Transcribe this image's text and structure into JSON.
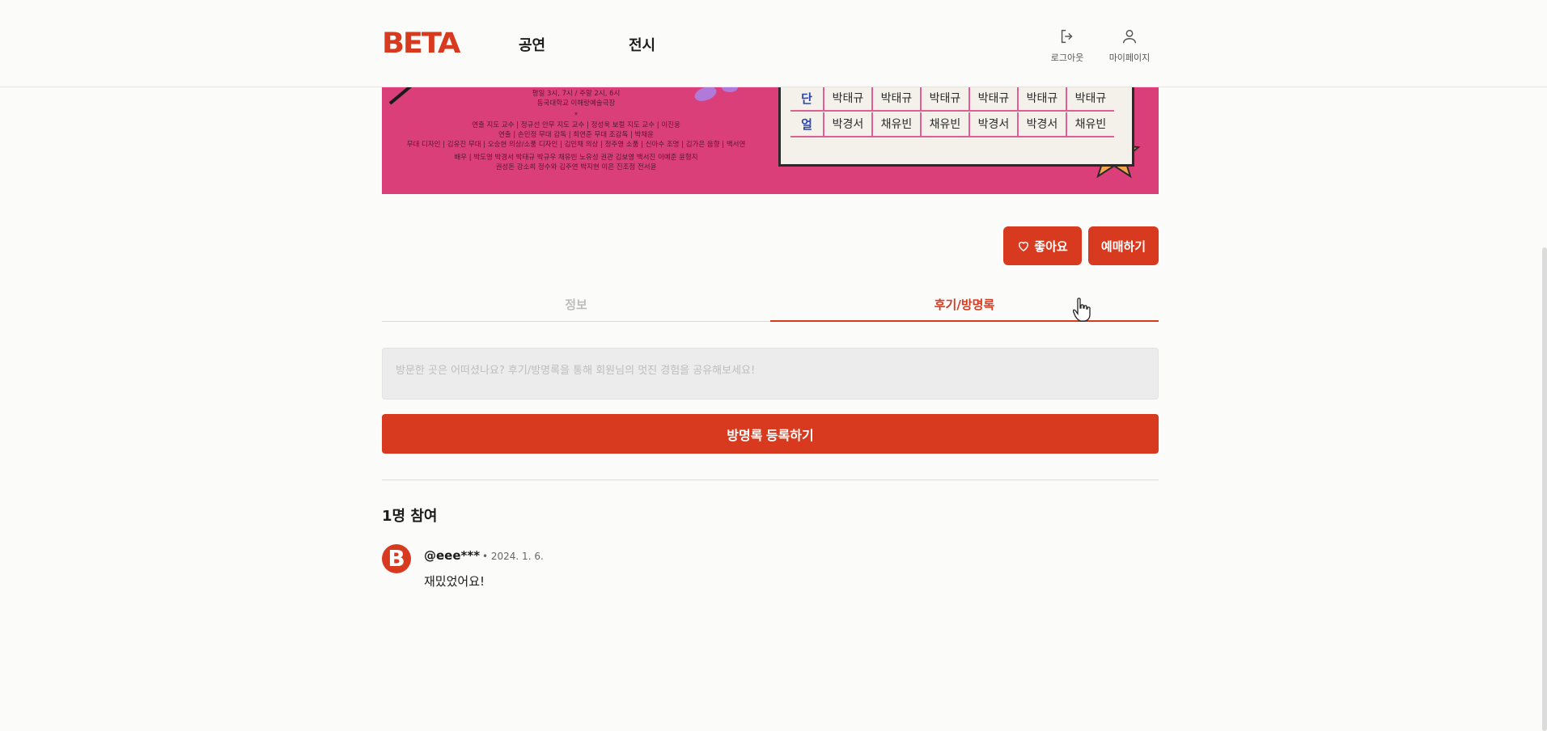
{
  "header": {
    "logo": "BETA",
    "nav": [
      {
        "label": "공연"
      },
      {
        "label": "전시"
      }
    ],
    "logout_label": "로그아웃",
    "mypage_label": "마이페이지"
  },
  "poster": {
    "credits": [
      "평일 3시, 7시 / 주말 2시, 6시",
      "동국대학교 이해랑예술극장",
      "*",
      "연출 지도 교수 | 정규선 안무 지도 교수 | 정성욱 보컬 지도 교수 | 이진웅",
      "연출 | 손민정 무대 감독 | 최연준 무대 조감독 | 박채윤",
      "무대 디자인 | 김유진 무대 | 오승현 의상/소품 디자인 | 김민채 의상 | 정주영 소품 | 신아수 조명 | 김가은 음향 | 백서연",
      "배우 | 박도영 박경서 박태규 박규우 채유빈 노유성 권관 김보영 백서진 이예준 윤형지",
      "권성돈 강소희 정수와 김주연 박지현 이은 진조정 전서윤"
    ],
    "rows": [
      {
        "head": "단",
        "cells": [
          "박태규",
          "박태규",
          "박태규",
          "박태규",
          "박태규",
          "박태규"
        ]
      },
      {
        "head": "얼",
        "cells": [
          "박경서",
          "채유빈",
          "채유빈",
          "박경서",
          "박경서",
          "채유빈"
        ]
      }
    ]
  },
  "actions": {
    "like_label": "좋아요",
    "book_label": "예매하기"
  },
  "tabs": {
    "info_label": "정보",
    "review_label": "후기/방명록"
  },
  "review_form": {
    "placeholder": "방문한 곳은 어떠셨나요? 후기/방명록을 통해 회원님의 멋진 경험을 공유해보세요!",
    "submit_label": "방명록 등록하기"
  },
  "reviews": {
    "participants_label": "1명 참여",
    "items": [
      {
        "avatar": "B",
        "username": "@eee***",
        "date": "• 2024. 1. 6.",
        "text": "재밌었어요!"
      }
    ]
  },
  "colors": {
    "accent": "#d73a1f",
    "poster_bg": "#db3f7a",
    "page_bg": "#fbfbfa"
  }
}
